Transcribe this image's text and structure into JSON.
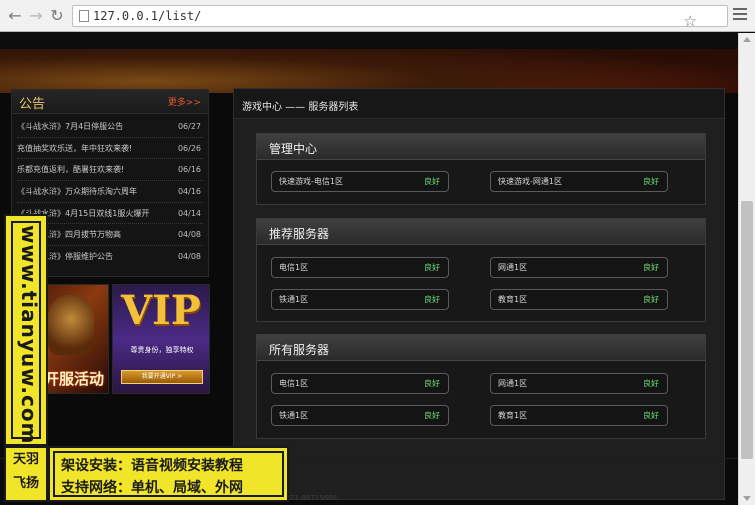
{
  "browser": {
    "url": "127.0.0.1/list/"
  },
  "notice": {
    "title": "公告",
    "more": "更多>>",
    "items": [
      {
        "text": "《斗战水浒》7月4日停服公告",
        "date": "06/27"
      },
      {
        "text": "充值抽奖欢乐送，年中狂欢来袭!",
        "date": "06/26"
      },
      {
        "text": "乐都充值返利，酷暑狂欢来袭!",
        "date": "06/16"
      },
      {
        "text": "《斗战水浒》万众期待乐淘六周年",
        "date": "04/16"
      },
      {
        "text": "《斗战水浒》4月15日双线1服火爆开",
        "date": "04/14"
      },
      {
        "text": "《斗战水浒》四月拔节万物高",
        "date": "04/08"
      },
      {
        "text": "《斗战水浒》停服维护公告",
        "date": "04/08"
      }
    ]
  },
  "promo": {
    "left_label": "开服活动",
    "vip_title": "VIP",
    "vip_subtitle": "尊贵身份，独享特权",
    "vip_button": "我要开通VIP >"
  },
  "main": {
    "title": "游戏中心 —— 服务器列表",
    "sections": [
      {
        "title": "管理中心",
        "servers": [
          {
            "name": "快速游戏-电信1区",
            "status": "良好"
          },
          {
            "name": "快速游戏-网通1区",
            "status": "良好"
          }
        ]
      },
      {
        "title": "推荐服务器",
        "servers": [
          {
            "name": "电信1区",
            "status": "良好"
          },
          {
            "name": "网通1区",
            "status": "良好"
          },
          {
            "name": "铁通1区",
            "status": "良好"
          },
          {
            "name": "教育1区",
            "status": "良好"
          }
        ]
      },
      {
        "title": "所有服务器",
        "servers": [
          {
            "name": "电信1区",
            "status": "良好"
          },
          {
            "name": "网通1区",
            "status": "良好"
          },
          {
            "name": "铁通1区",
            "status": "良好"
          },
          {
            "name": "教育1区",
            "status": "良好"
          }
        ]
      }
    ]
  },
  "footer": {
    "text": "电话：0571-88715666"
  },
  "watermark": {
    "site": "www.tianyuw.com",
    "logo_top": "天羽",
    "logo_bottom": "飞扬",
    "line1": "架设安装：语音视频安装教程",
    "line2": "支持网络：单机、局域、外网"
  },
  "colors": {
    "accent_gold": "#e8c36a",
    "more_red": "#e4572e",
    "status_green": "#6fe07a",
    "watermark_yellow": "#f1e52a"
  }
}
